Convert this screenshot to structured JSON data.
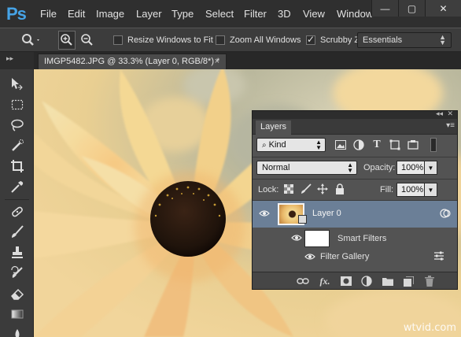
{
  "app": {
    "logo": "Ps"
  },
  "menu": [
    "File",
    "Edit",
    "Image",
    "Layer",
    "Type",
    "Select",
    "Filter",
    "3D",
    "View",
    "Window"
  ],
  "window_controls": {
    "minimize": "—",
    "maximize": "▢",
    "close": "✕"
  },
  "options_bar": {
    "resize_windows_label": "Resize Windows to Fit",
    "resize_windows_checked": false,
    "zoom_all_windows_label": "Zoom All Windows",
    "zoom_all_windows_checked": false,
    "scrubby_zoom_label": "Scrubby Z",
    "scrubby_zoom_checked": true,
    "workspace": "Essentials"
  },
  "document": {
    "tab_title": "IMGP5482.JPG @ 33.3% (Layer 0, RGB/8*) *",
    "tab_close": "×"
  },
  "layers_panel": {
    "tab_label": "Layers",
    "filter_kind": "Kind",
    "blend_mode": "Normal",
    "opacity_label": "Opacity:",
    "opacity_value": "100%",
    "lock_label": "Lock:",
    "fill_label": "Fill:",
    "fill_value": "100%",
    "layers": [
      {
        "name": "Layer 0",
        "selected": true,
        "smart_object": true
      }
    ],
    "smart_filters_label": "Smart Filters",
    "filters": [
      "Filter Gallery"
    ]
  },
  "watermark": "wtvid.com",
  "colors": {
    "app_bg": "#2b2b2b",
    "panel_bg": "#535353",
    "selected_layer": "#6b7f97",
    "logo_blue": "#46a3e6"
  }
}
